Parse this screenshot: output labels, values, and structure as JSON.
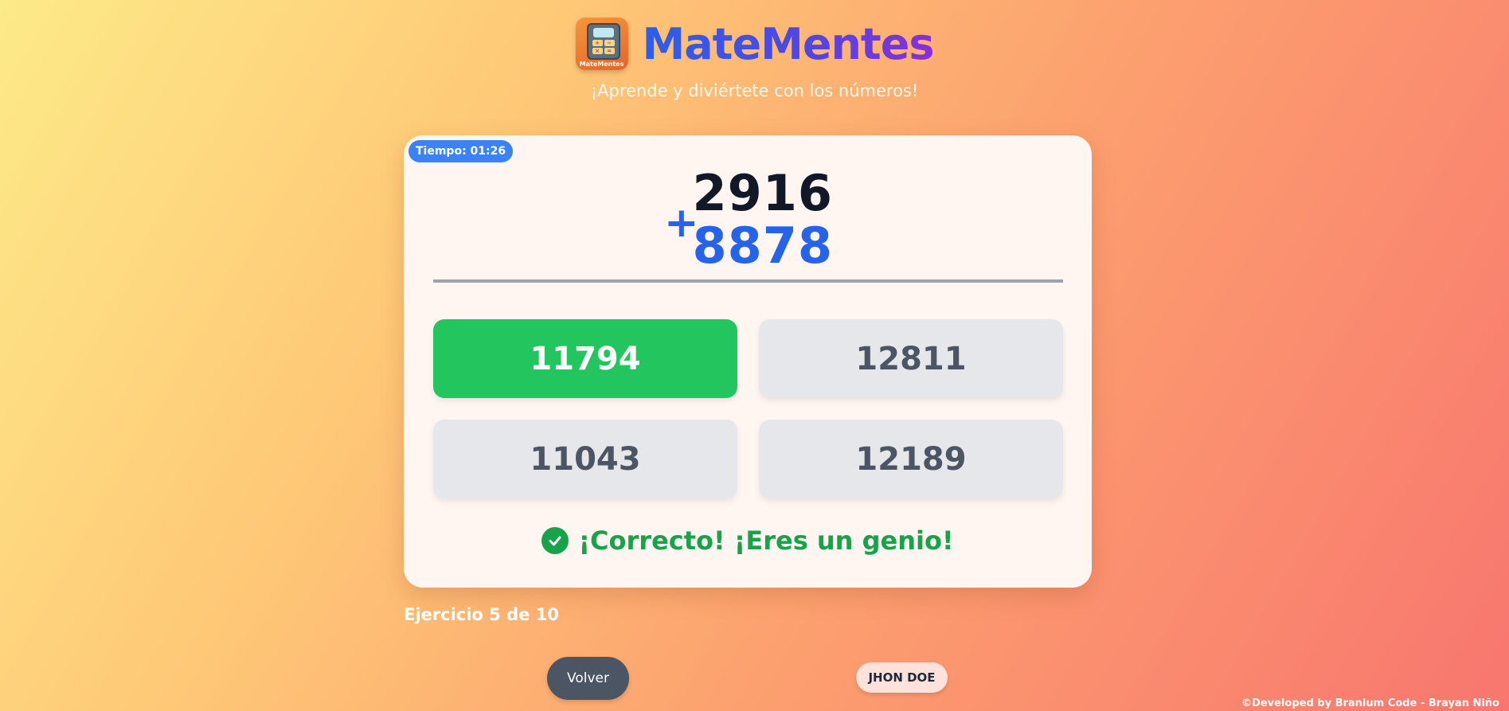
{
  "header": {
    "logo_text": "MateMentes",
    "logo_keys": [
      "+",
      "−",
      "×",
      "="
    ],
    "title": "MateMentes",
    "tagline": "¡Aprende y diviértete con los números!"
  },
  "exercise": {
    "timer": "Tiempo: 01:26",
    "top_number": "2916",
    "bottom_number": "8878",
    "operator": "+",
    "options": [
      {
        "label": "11794",
        "state": "correct"
      },
      {
        "label": "12811",
        "state": "default"
      },
      {
        "label": "11043",
        "state": "default"
      },
      {
        "label": "12189",
        "state": "default"
      }
    ],
    "feedback": "¡Correcto! ¡Eres un genio!",
    "progress": "Ejercicio 5 de 10"
  },
  "controls": {
    "back_label": "Volver",
    "user_name": "JHON DOE"
  },
  "footer": {
    "credit": "©Developed by Branium Code - Brayan Niño"
  },
  "colors": {
    "accent": "#2563eb",
    "correct": "#22c55e",
    "feedback": "#16a34a",
    "timer_badge": "#3b82f6"
  },
  "icons": {
    "logo": "calculator-mascot-icon",
    "feedback": "check-circle-icon"
  }
}
